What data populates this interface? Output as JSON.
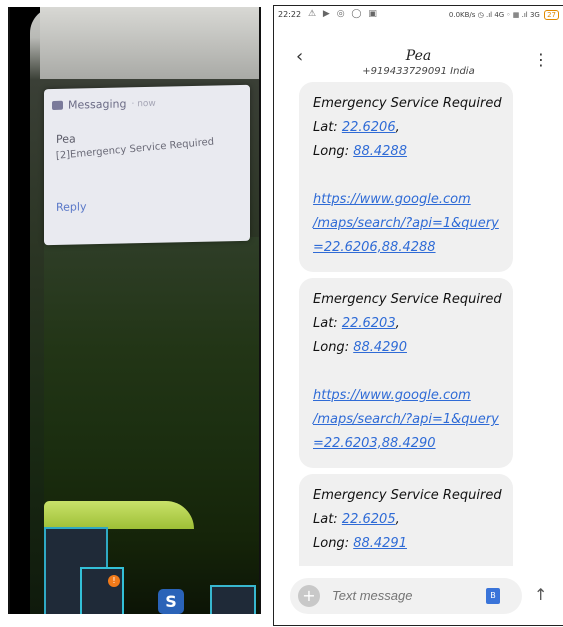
{
  "left": {
    "notification": {
      "app_name": "Messaging",
      "time": "· now",
      "sender": "Pea",
      "body": "[2]Emergency Service Required",
      "reply_label": "Reply"
    },
    "badge_count": "!",
    "s_icon_letter": "S"
  },
  "status_bar": {
    "time": "22:22",
    "icons": "⚠ ▶ ◎ ◯ ▣",
    "right": "0.0KB/s ◷ .ıl 4G ◦ ▦ .ıl 3G",
    "battery": "27"
  },
  "header": {
    "back_icon": "‹",
    "contact_name": "Pea",
    "contact_number": "+919433729091 India",
    "menu_icon": "⋮"
  },
  "messages": [
    {
      "title": "Emergency Service Required",
      "lat_label": "Lat: ",
      "lat": "22.6206",
      "long_label": "Long: ",
      "long": "88.4288",
      "link_1": "https://www.google.com",
      "link_2": "/maps/search/?api=1&query",
      "link_3": "=22.6206,88.4288"
    },
    {
      "title": "Emergency Service Required",
      "lat_label": "Lat: ",
      "lat": "22.6203",
      "long_label": "Long: ",
      "long": "88.4290",
      "link_1": "https://www.google.com",
      "link_2": "/maps/search/?api=1&query",
      "link_3": "=22.6203,88.4290"
    },
    {
      "title": "Emergency Service Required",
      "lat_label": "Lat: ",
      "lat": "22.6205",
      "long_label": "Long: ",
      "long": "88.4291"
    }
  ],
  "compose": {
    "add_icon": "+",
    "placeholder": "Text message",
    "sim_icon": "B",
    "send_icon": "↑"
  }
}
